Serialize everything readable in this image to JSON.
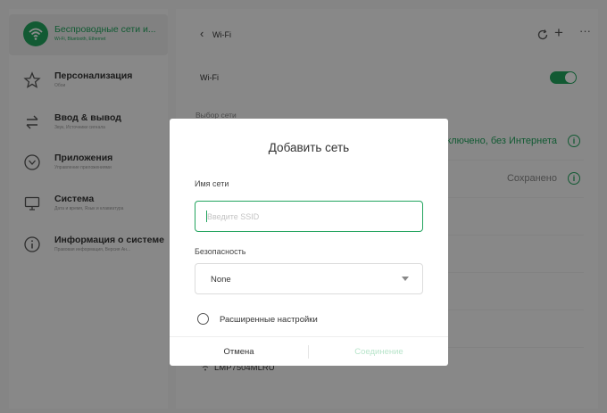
{
  "colors": {
    "accent": "#22a45e",
    "accent_disabled": "#b9e5cb"
  },
  "sidebar": {
    "items": [
      {
        "title": "Беспроводные сети и...",
        "subtitle": "Wi-Fi, Bluetooth, Ethernet",
        "icon": "wifi-icon",
        "active": true
      },
      {
        "title": "Персонализация",
        "subtitle": "Обои",
        "icon": "star-icon"
      },
      {
        "title": "Ввод & вывод",
        "subtitle": "Звук, Источники сигнала",
        "icon": "swap-arrows-icon"
      },
      {
        "title": "Приложения",
        "subtitle": "Управление приложениями",
        "icon": "app-icon"
      },
      {
        "title": "Система",
        "subtitle": "Дата и время, Язык и клавиатура",
        "icon": "monitor-icon"
      },
      {
        "title": "Информация о системе",
        "subtitle": "Правовая информация, Версия Ан...",
        "icon": "info-icon"
      }
    ]
  },
  "main": {
    "header": {
      "back_icon": "‹",
      "title": "Wi-Fi",
      "refresh_icon": "refresh-icon",
      "add_icon": "+",
      "more_icon": "···"
    },
    "wifi_label": "Wi-Fi",
    "wifi_enabled": true,
    "select_network_label": "Выбор сети",
    "networks": [
      {
        "status": "ключено, без Интернета"
      },
      {
        "status": "Сохранено"
      }
    ],
    "bottom_network": "LMP7504MLRU"
  },
  "dialog": {
    "title": "Добавить сеть",
    "network_name_label": "Имя сети",
    "ssid_placeholder": "Введите SSID",
    "ssid_value": "",
    "security_label": "Безопасность",
    "security_value": "None",
    "advanced_label": "Расширенные настройки",
    "cancel_label": "Отмена",
    "connect_label": "Соединение"
  }
}
